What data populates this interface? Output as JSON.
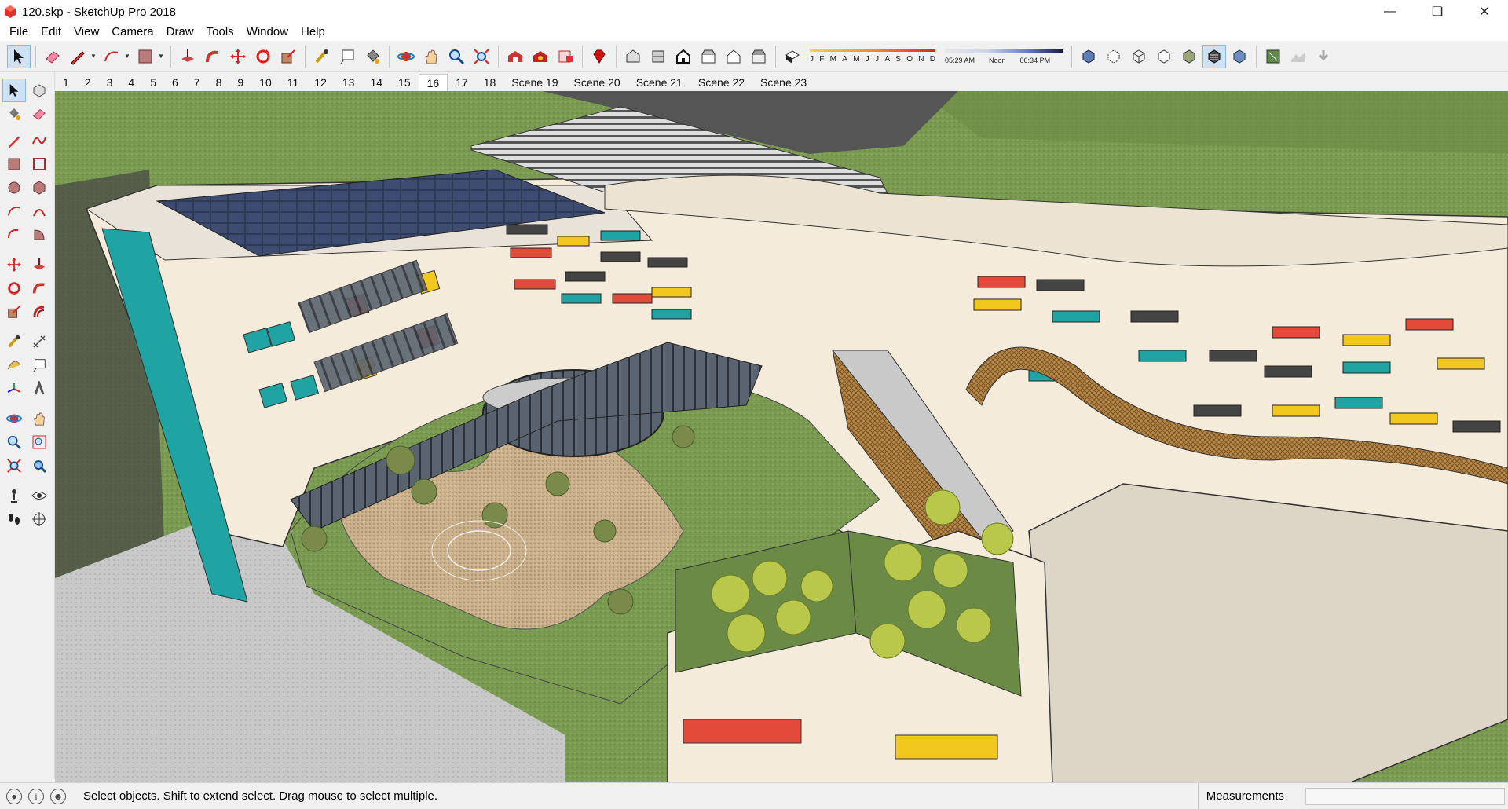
{
  "window": {
    "title": "120.skp - SketchUp Pro 2018",
    "app_icon": "sketchup-logo-icon"
  },
  "window_controls": {
    "minimize": "minimize-icon",
    "restore": "restore-icon",
    "close": "close-icon"
  },
  "menubar": {
    "items": [
      "File",
      "Edit",
      "View",
      "Camera",
      "Draw",
      "Tools",
      "Window",
      "Help"
    ]
  },
  "shadows": {
    "months": [
      "J",
      "F",
      "M",
      "A",
      "M",
      "J",
      "J",
      "A",
      "S",
      "O",
      "N",
      "D"
    ],
    "time_start": "05:29 AM",
    "time_noon": "Noon",
    "time_end": "06:34 PM"
  },
  "scenes": {
    "tabs": [
      "1",
      "2",
      "3",
      "4",
      "5",
      "6",
      "7",
      "8",
      "9",
      "10",
      "11",
      "12",
      "13",
      "14",
      "15",
      "16",
      "17",
      "18",
      "Scene 19",
      "Scene 20",
      "Scene 21",
      "Scene 22",
      "Scene 23"
    ],
    "active": "16"
  },
  "status": {
    "message": "Select objects. Shift to extend select. Drag mouse to select multiple.",
    "measurements_label": "Measurements",
    "measurements_value": ""
  },
  "colors": {
    "accent_teal": "#1fa3a3",
    "accent_red": "#e24a3a",
    "accent_yellow": "#f2c81e",
    "building_cream": "#f6ecdc"
  }
}
